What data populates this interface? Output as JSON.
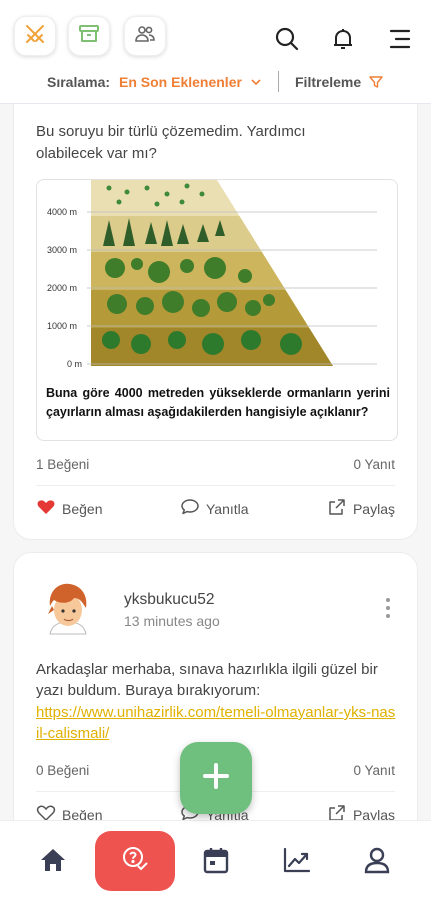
{
  "header": {
    "icons": [
      "swords-icon",
      "archive-icon",
      "users-icon",
      "search-icon",
      "bell-icon",
      "menu-icon"
    ],
    "sort_label": "Sıralama:",
    "sort_value": "En Son Eklenenler",
    "filter_label": "Filtreleme"
  },
  "colors": {
    "accent": "#ef7f35",
    "link": "#e0b100",
    "fab": "#6fc07f",
    "ask": "#ef5350",
    "like": "#e53935"
  },
  "posts": [
    {
      "text": "Bu soruyu bir türlü çözemedim. Yardımcı olabilecek var mı?",
      "image": {
        "altitude_labels": [
          "4000 m",
          "3000 m",
          "2000 m",
          "1000 m",
          "0 m"
        ],
        "caption": "Buna göre 4000 metreden yükseklerde ormanların yerini çayırların alması aşağıdakilerden hangisiyle açıklanır?"
      },
      "likes": "1 Beğeni",
      "replies": "0 Yanıt",
      "liked": true,
      "actions": {
        "like": "Beğen",
        "reply": "Yanıtla",
        "share": "Paylaş"
      }
    },
    {
      "username": "yksbukucu52",
      "time": "13 minutes ago",
      "text": "Arkadaşlar merhaba, sınava hazırlıkla ilgili güzel bir yazı buldum. Buraya bırakıyorum:",
      "link": "https://www.unihazirlik.com/temeli-olmayanlar-yks-nasil-calismali/",
      "likes": "0 Beğeni",
      "replies": "0 Yanıt",
      "liked": false,
      "actions": {
        "like": "Beğen",
        "reply": "Yanıtla",
        "share": "Paylaş"
      }
    }
  ],
  "bottom_nav": [
    "home-icon",
    "ask-question-icon",
    "calendar-icon",
    "chart-icon",
    "profile-icon"
  ]
}
